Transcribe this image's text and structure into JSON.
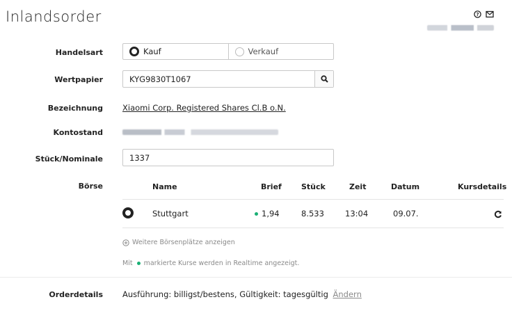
{
  "header": {
    "title": "Inlandsorder",
    "help_icon": "help-circle-icon",
    "mail_icon": "mail-icon"
  },
  "form": {
    "handelsart": {
      "label": "Handelsart",
      "options": [
        "Kauf",
        "Verkauf"
      ],
      "selected": "Kauf"
    },
    "wertpapier": {
      "label": "Wertpapier",
      "value": "KYG9830T1067"
    },
    "bezeichnung": {
      "label": "Bezeichnung",
      "value": "Xiaomi Corp. Registered Shares Cl.B o.N."
    },
    "kontostand": {
      "label": "Kontostand"
    },
    "stueck": {
      "label": "Stück/Nominale",
      "value": "1337"
    },
    "boerse": {
      "label": "Börse",
      "columns": [
        "Name",
        "Brief",
        "Stück",
        "Zeit",
        "Datum",
        "Kursdetails"
      ],
      "rows": [
        {
          "name": "Stuttgart",
          "brief": "1,94",
          "stueck": "8.533",
          "zeit": "13:04",
          "datum": "09.07.",
          "realtime": true,
          "selected": true
        }
      ],
      "more_link": "Weitere Börsenplätze anzeigen",
      "note_prefix": "Mit",
      "note_suffix": "markierte Kurse werden in Realtime angezeigt."
    },
    "orderdetails": {
      "label": "Orderdetails",
      "value": "Ausführung: billigst/bestens, Gültigkeit: tagesgültig",
      "change_link": "Ändern"
    }
  },
  "colors": {
    "realtime_dot": "#1aaf75",
    "border": "#c8c8c8"
  }
}
